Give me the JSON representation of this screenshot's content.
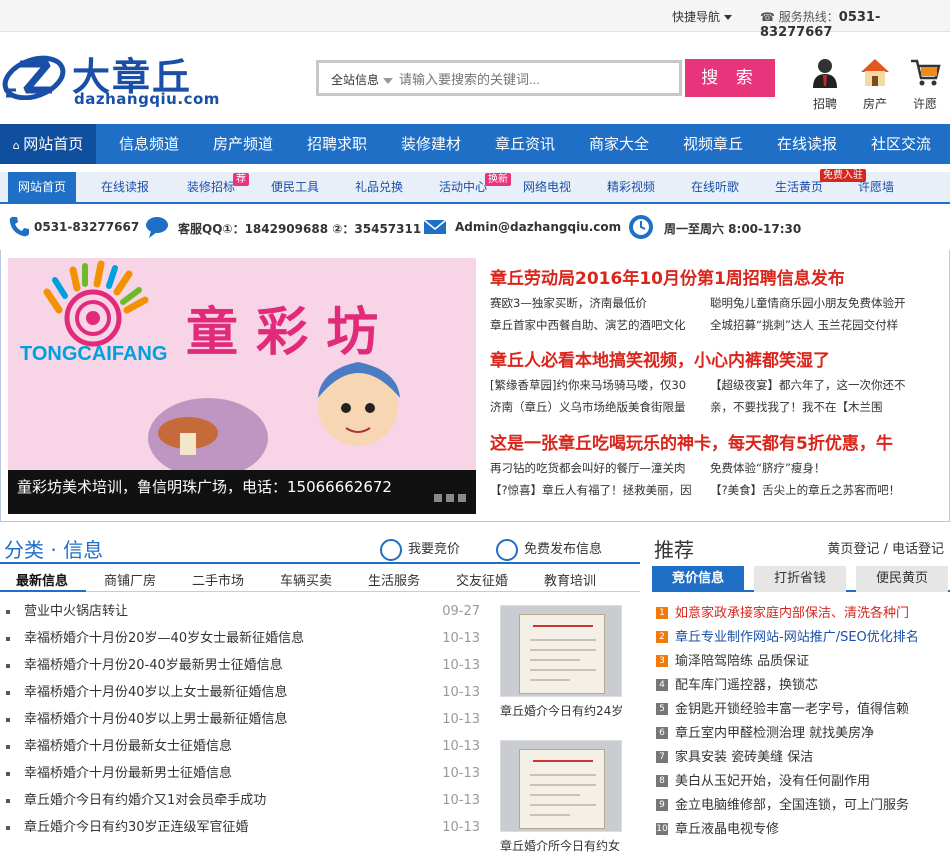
{
  "topbar": {
    "quick_nav": "快捷导航",
    "hotline_label": "服务热线：",
    "hotline_number": "0531-83277667"
  },
  "logo": {
    "zh": "大章丘",
    "en": "dazhangqiu.com"
  },
  "search": {
    "category": "全站信息",
    "placeholder": "请输入要搜索的关键词...",
    "button": "搜 索"
  },
  "quick_icons": [
    {
      "label": "招聘",
      "icon": "recruit-person-icon"
    },
    {
      "label": "房产",
      "icon": "house-icon"
    },
    {
      "label": "许愿",
      "icon": "shopping-cart-icon"
    }
  ],
  "main_nav": [
    "网站首页",
    "信息频道",
    "房产频道",
    "招聘求职",
    "装修建材",
    "章丘资讯",
    "商家大全",
    "视频章丘",
    "在线读报",
    "社区交流"
  ],
  "sub_nav": [
    "网站首页",
    "在线读报",
    "装修招标",
    "便民工具",
    "礼品兑换",
    "活动中心",
    "网络电视",
    "精彩视频",
    "在线听歌",
    "生活黄页",
    "许愿墙"
  ],
  "sub_badges": {
    "decor": "荐",
    "activity": "换新",
    "yellow": "免费入驻"
  },
  "contact": {
    "phone": "0531-83277667",
    "qq": "客服QQ①：1842909688 ②：35457311",
    "email": "Admin@dazhangqiu.com",
    "hours": "周一至周六 8:00-17:30"
  },
  "slider": {
    "caption": "童彩坊美术培训，鲁信明珠广场，电话：15066662672",
    "logo_en": "TONGCAIFANG",
    "logo_zh": "童 彩 坊"
  },
  "news": [
    {
      "headline": "章丘劳动局2016年10月份第1周招聘信息发布",
      "rows": [
        [
          "赛欧3—独家买断，济南最低价",
          "聪明兔儿童情商乐园小朋友免费体验开"
        ],
        [
          "章丘首家中西餐自助、演艺的酒吧文化",
          "全城招募“挑刺”达人 玉兰花园交付样"
        ]
      ]
    },
    {
      "headline": "章丘人必看本地搞笑视频，小心内裤都笑湿了",
      "rows": [
        [
          "[繁缘香草园]约你来马场骑马喽，仅30",
          "【超级夜宴】都六年了，这一次你还不"
        ],
        [
          "济南（章丘）义乌市场绝版美食街限量",
          "亲，不要找我了！我不在【木兰围"
        ]
      ]
    },
    {
      "headline": "这是一张章丘吃喝玩乐的神卡，每天都有5折优惠，牛",
      "rows": [
        [
          "再刁钻的吃货都会叫好的餐厅—潼关肉",
          "免费体验“脐疗”瘦身！"
        ],
        [
          "【?惊喜】章丘人有福了！拯救美丽，因",
          "【?美食】舌尖上的章丘之苏客而吧！"
        ]
      ]
    }
  ],
  "classified": {
    "title": "分类 · 信息",
    "bid": "我要竞价",
    "post": "免费发布信息",
    "tabs": [
      "最新信息",
      "商铺厂房",
      "二手市场",
      "车辆买卖",
      "生活服务",
      "交友征婚",
      "教育培训"
    ],
    "items": [
      {
        "text": "营业中火锅店转让",
        "date": "09-27"
      },
      {
        "text": "幸福桥婚介十月份20岁—40岁女士最新征婚信息",
        "date": "10-13"
      },
      {
        "text": "幸福桥婚介十月份20-40岁最新男士征婚信息",
        "date": "10-13"
      },
      {
        "text": "幸福桥婚介十月份40岁以上女士最新征婚信息",
        "date": "10-13"
      },
      {
        "text": "幸福桥婚介十月份40岁以上男士最新征婚信息",
        "date": "10-13"
      },
      {
        "text": "幸福桥婚介十月份最新女士征婚信息",
        "date": "10-13"
      },
      {
        "text": "幸福桥婚介十月份最新男士征婚信息",
        "date": "10-13"
      },
      {
        "text": "章丘婚介今日有约婚介又1对会员牵手成功",
        "date": "10-13"
      },
      {
        "text": "章丘婚介今日有约30岁正连级军官征婚",
        "date": "10-13"
      }
    ],
    "thumbs": [
      "章丘婚介今日有约24岁",
      "章丘婚介所今日有约女"
    ]
  },
  "recommend": {
    "title": "推荐",
    "links": "黄页登记 / 电话登记",
    "tabs": [
      "竞价信息",
      "打折省钱",
      "便民黄页"
    ],
    "items": [
      {
        "n": "1",
        "text": "如意家政承接家庭内部保洁、清洗各种门"
      },
      {
        "n": "2",
        "text": "章丘专业制作网站-网站推广/SEO优化排名"
      },
      {
        "n": "3",
        "text": "瑜泽陪驾陪练 品质保证"
      },
      {
        "n": "4",
        "text": "配车库门遥控器，换锁芯"
      },
      {
        "n": "5",
        "text": "金钥匙开锁经验丰富一老字号，值得信赖"
      },
      {
        "n": "6",
        "text": "章丘室内甲醛检测治理 就找美房净"
      },
      {
        "n": "7",
        "text": "家具安装 瓷砖美缝 保洁"
      },
      {
        "n": "8",
        "text": "美白从玉妃开始，没有任何副作用"
      },
      {
        "n": "9",
        "text": "金立电脑维修部，全国连锁，可上门服务"
      },
      {
        "n": "10",
        "text": "章丘液晶电视专修"
      }
    ]
  },
  "colors": {
    "primary": "#1e6fc5",
    "accent": "#e8347b",
    "headline": "#d9261c"
  }
}
